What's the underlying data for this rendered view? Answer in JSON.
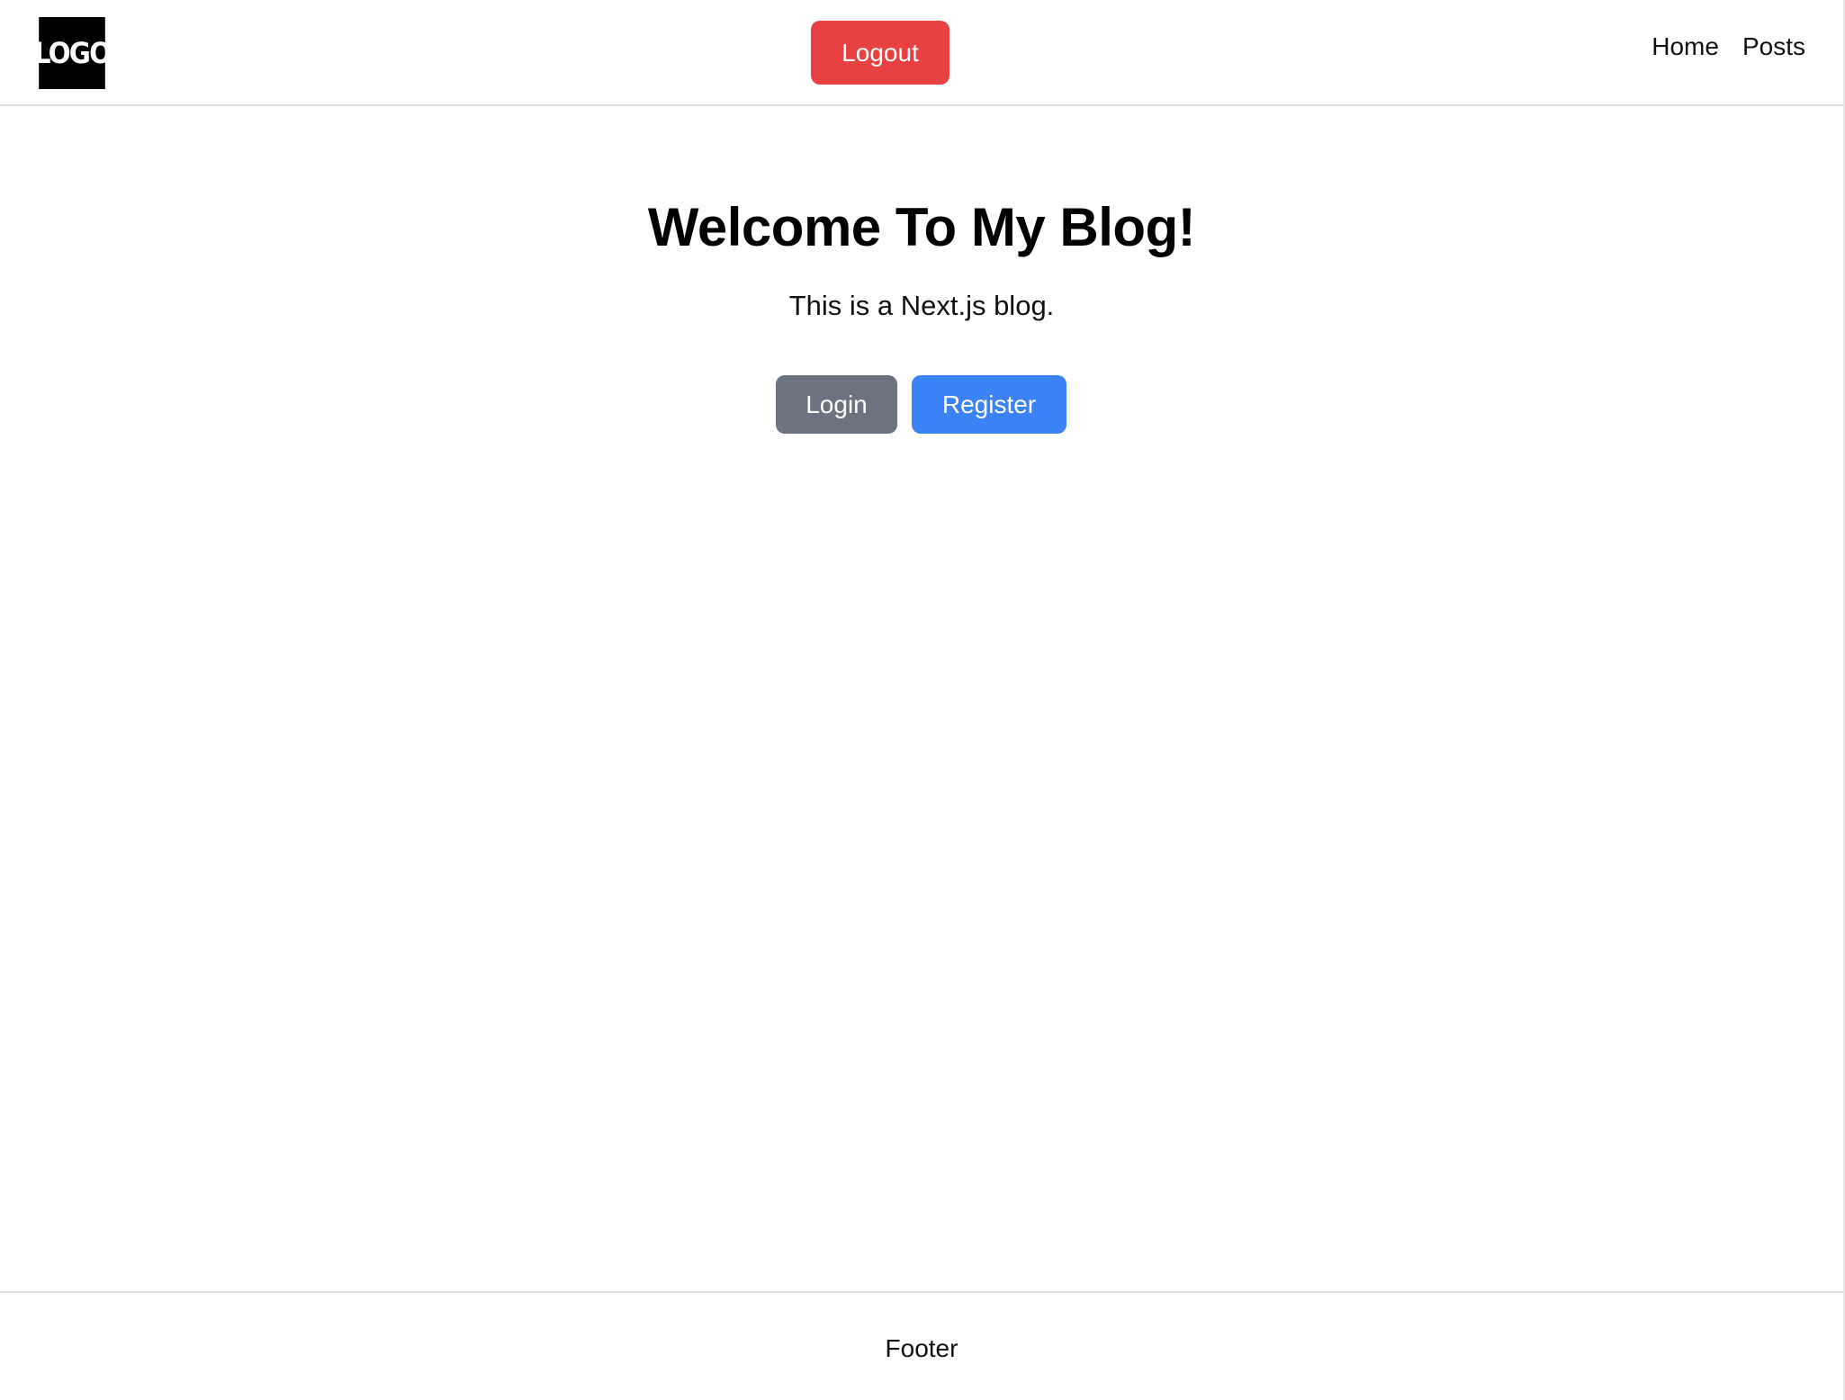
{
  "header": {
    "logo_text": "LOGO",
    "logout_label": "Logout",
    "nav": [
      {
        "label": "Home"
      },
      {
        "label": "Posts"
      }
    ]
  },
  "main": {
    "title": "Welcome To My Blog!",
    "subtitle": "This is a Next.js blog.",
    "login_label": "Login",
    "register_label": "Register"
  },
  "footer": {
    "text": "Footer"
  },
  "colors": {
    "logout": "#e84142",
    "login": "#6b7280",
    "register": "#3b82f6",
    "logo_bg": "#000000"
  }
}
